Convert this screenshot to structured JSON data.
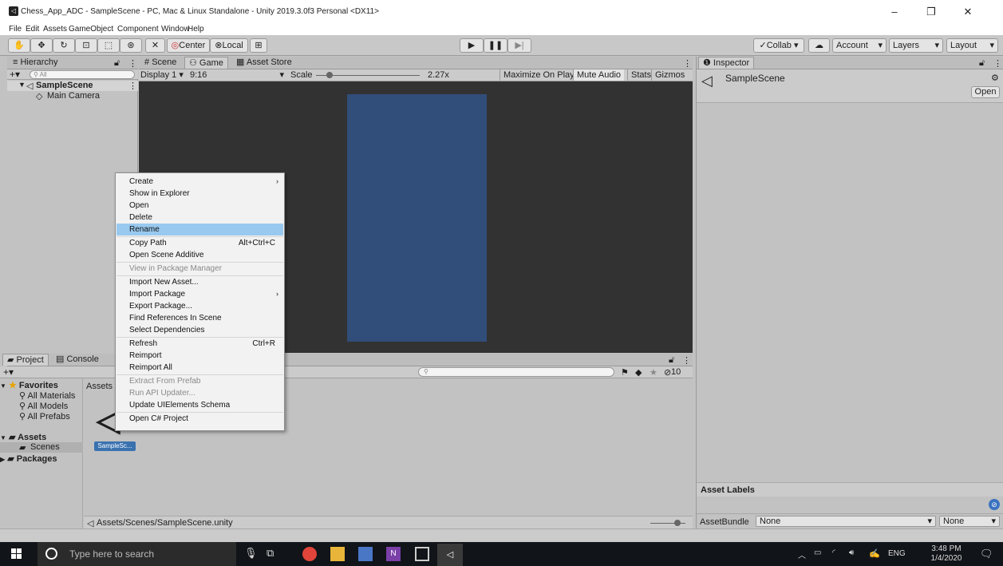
{
  "window": {
    "title": "Chess_App_ADC - SampleScene - PC, Mac & Linux Standalone - Unity 2019.3.0f3 Personal <DX11>",
    "menu": [
      "File",
      "Edit",
      "Assets",
      "GameObject",
      "Component",
      "Window",
      "Help"
    ]
  },
  "toolbar": {
    "center_label": "Center",
    "local_label": "Local",
    "collab_label": "Collab",
    "account_label": "Account",
    "layers_label": "Layers",
    "layout_label": "Layout"
  },
  "hierarchy": {
    "tab": "Hierarchy",
    "search_placeholder": "All",
    "scene": "SampleScene",
    "items": [
      "Main Camera"
    ]
  },
  "views": {
    "tabs": [
      "Scene",
      "Game",
      "Asset Store"
    ],
    "display": "Display 1",
    "aspect": "9:16",
    "scale_label": "Scale",
    "scale_value": "2.27x",
    "scale_level": 0.1,
    "maximize": "Maximize On Play",
    "mute": "Mute Audio",
    "stats": "Stats",
    "gizmos": "Gizmos"
  },
  "inspector": {
    "tab": "Inspector",
    "object": "SampleScene",
    "open_label": "Open",
    "asset_labels": "Asset Labels",
    "asset_bundle_label": "AssetBundle",
    "asset_bundle_value": "None",
    "asset_bundle_variant": "None"
  },
  "project": {
    "tabs": [
      "Project",
      "Console"
    ],
    "favorites": "Favorites",
    "favorite_items": [
      "All Materials",
      "All Models",
      "All Prefabs"
    ],
    "assets": "Assets",
    "asset_folders": [
      "Scenes"
    ],
    "packages": "Packages",
    "breadcrumb": "Assets",
    "selected_asset": "SampleSc...",
    "path": "Assets/Scenes/SampleScene.unity",
    "hidden_count": "10"
  },
  "context_menu": {
    "items": [
      {
        "label": "Create",
        "shortcut": "",
        "arrow": true,
        "disabled": false,
        "highlight": false
      },
      {
        "label": "Show in Explorer",
        "shortcut": "",
        "arrow": false,
        "disabled": false,
        "highlight": false
      },
      {
        "label": "Open",
        "shortcut": "",
        "arrow": false,
        "disabled": false,
        "highlight": false
      },
      {
        "label": "Delete",
        "shortcut": "",
        "arrow": false,
        "disabled": false,
        "highlight": false
      },
      {
        "label": "Rename",
        "shortcut": "",
        "arrow": false,
        "disabled": false,
        "highlight": true
      },
      {
        "label": "Copy Path",
        "shortcut": "Alt+Ctrl+C",
        "arrow": false,
        "disabled": false,
        "highlight": false
      },
      {
        "label": "Open Scene Additive",
        "shortcut": "",
        "arrow": false,
        "disabled": false,
        "highlight": false
      },
      {
        "label": "View in Package Manager",
        "shortcut": "",
        "arrow": false,
        "disabled": true,
        "highlight": false
      },
      {
        "label": "Import New Asset...",
        "shortcut": "",
        "arrow": false,
        "disabled": false,
        "highlight": false
      },
      {
        "label": "Import Package",
        "shortcut": "",
        "arrow": true,
        "disabled": false,
        "highlight": false
      },
      {
        "label": "Export Package...",
        "shortcut": "",
        "arrow": false,
        "disabled": false,
        "highlight": false
      },
      {
        "label": "Find References In Scene",
        "shortcut": "",
        "arrow": false,
        "disabled": false,
        "highlight": false
      },
      {
        "label": "Select Dependencies",
        "shortcut": "",
        "arrow": false,
        "disabled": false,
        "highlight": false
      },
      {
        "label": "Refresh",
        "shortcut": "Ctrl+R",
        "arrow": false,
        "disabled": false,
        "highlight": false
      },
      {
        "label": "Reimport",
        "shortcut": "",
        "arrow": false,
        "disabled": false,
        "highlight": false
      },
      {
        "label": "Reimport All",
        "shortcut": "",
        "arrow": false,
        "disabled": false,
        "highlight": false
      },
      {
        "label": "Extract From Prefab",
        "shortcut": "",
        "arrow": false,
        "disabled": true,
        "highlight": false
      },
      {
        "label": "Run API Updater...",
        "shortcut": "",
        "arrow": false,
        "disabled": true,
        "highlight": false
      },
      {
        "label": "Update UIElements Schema",
        "shortcut": "",
        "arrow": false,
        "disabled": false,
        "highlight": false
      },
      {
        "label": "Open C# Project",
        "shortcut": "",
        "arrow": false,
        "disabled": false,
        "highlight": false
      }
    ]
  },
  "taskbar": {
    "search_placeholder": "Type here to search",
    "language": "ENG",
    "time": "3:48 PM",
    "date": "1/4/2020"
  },
  "colors": {
    "game_bg": "#323232",
    "game_canvas": "#314d79",
    "menu_highlight": "#99c9ef",
    "selection": "#3a72b0"
  }
}
